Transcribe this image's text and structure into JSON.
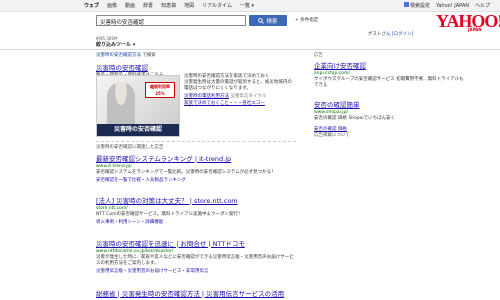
{
  "nav": {
    "tabs": [
      "ウェブ",
      "画像",
      "動画",
      "辞書",
      "知恵袋",
      "地図",
      "リアルタイム",
      "一覧 ▾"
    ],
    "right": {
      "safe_search": "検索設定",
      "yahoo_japan": "Yahoo! JAPAN",
      "help": "ヘルプ"
    }
  },
  "search": {
    "query": "災害時の安否確認",
    "button_label": "検索",
    "conditions_label": "+ 条件指定"
  },
  "logo": {
    "text": "YAHOO!",
    "sub": "JAPAN"
  },
  "user": {
    "guest": "ゲスト",
    "login": "さん [ログイン]"
  },
  "result_count": "約95,300件",
  "filter_label": "絞り込みツール ▾",
  "breadcrumb": {
    "key": "災害時の安否確認方法",
    "sep": "で検索"
  },
  "featured": {
    "title": "災害時の安否確認",
    "meta": "製造・開発元・資料請求はこちら",
    "badge": "継続利用率 25%",
    "banner": "災害時の安否確認",
    "text_lines": [
      "災害時の安否確認方法を家族で決めておく",
      "災害発生時は大量の電話が殺到すると、被災地域内の",
      "電話はつながりにくくなります。"
    ],
    "link1": "災害時の電話利用方法",
    "link2": "災害伝言ダイヤル",
    "links": "家族で決めておくこと・・・各社エコー"
  },
  "section_label": "災害時の安否確認に関連した広告",
  "results": [
    {
      "title": "最新安否確認システムランキング | it-trend.jp",
      "url": "www.it-trend.jp/",
      "desc": "安否確認システムをランキングで一覧比較。災害時の安否確認システムが必ず見つかる！",
      "links": "安否確認を一覧で比較・人気製品ランキング"
    },
    {
      "title": "[法人] 災害時の対策は大丈夫？ | store.ntt.com",
      "url": "store.ntt.com/",
      "desc": "NTT Comの安否確認サービス。無料トライアル実施中＆クーポン発行！",
      "links": "導入事例・利用シーン・詳細機能"
    },
    {
      "title": "災害時の安否確認を迅速に | お問合せ | NTTドコモ",
      "url": "www.nttdocomo.co.jp/biz/disaster/",
      "desc": "災害が発生した時に、家族や友人などに安否確認ができる災害用伝言板・災害用音声お届けサービスの利用方法をご案内します。",
      "links": "災害用伝言板・災害用音声お届けサービス・非常用伝言"
    },
    {
      "title": "総務省 | 災害発生時の安否確認方法 | 災害用伝言サービスの活用",
      "url": "www.soumu.go.jp/",
      "desc": "",
      "links": ""
    }
  ],
  "ads": {
    "label": "広告",
    "items": [
      {
        "title": "企業向け安否確認",
        "url": "anpi.cstap.com/",
        "desc": "サイボウズグループの安否確認サービス 初期費用不要、無料トライアルもできる"
      },
      {
        "title": "安否の確認簡単",
        "url": "www.shopai.jp/",
        "desc": "安否の確認 価格 Shopaiでいちばん安く"
      }
    ],
    "link": "安否の確認 価格",
    "about": "広告掲載について"
  }
}
